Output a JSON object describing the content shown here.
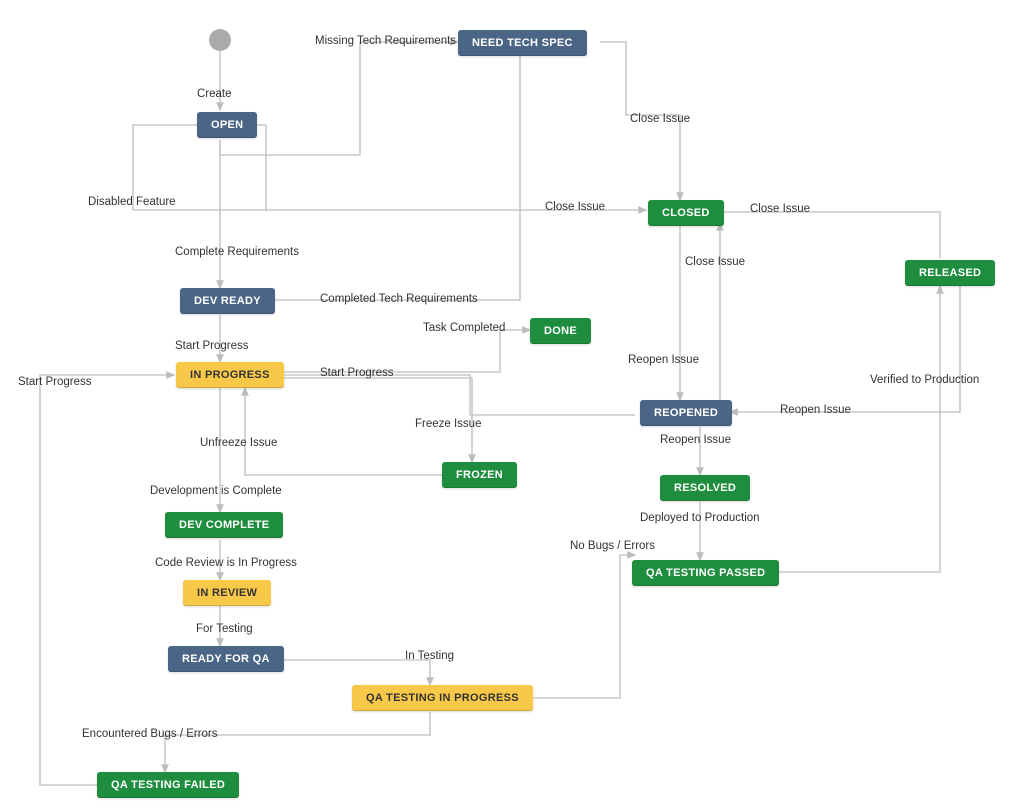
{
  "diagram": {
    "type": "workflow-state-diagram",
    "nodes": {
      "start": {
        "kind": "start"
      },
      "open": {
        "label": "OPEN",
        "color": "blue"
      },
      "need_tech_spec": {
        "label": "NEED TECH SPEC",
        "color": "blue"
      },
      "dev_ready": {
        "label": "DEV READY",
        "color": "blue"
      },
      "in_progress": {
        "label": "IN PROGRESS",
        "color": "yellow"
      },
      "frozen": {
        "label": "FROZEN",
        "color": "green"
      },
      "done": {
        "label": "DONE",
        "color": "green"
      },
      "dev_complete": {
        "label": "DEV COMPLETE",
        "color": "green"
      },
      "in_review": {
        "label": "IN REVIEW",
        "color": "yellow"
      },
      "ready_for_qa": {
        "label": "READY FOR QA",
        "color": "blue"
      },
      "qa_in_progress": {
        "label": "QA TESTING IN PROGRESS",
        "color": "yellow"
      },
      "qa_failed": {
        "label": "QA TESTING FAILED",
        "color": "green"
      },
      "closed": {
        "label": "CLOSED",
        "color": "green"
      },
      "reopened": {
        "label": "REOPENED",
        "color": "blue"
      },
      "resolved": {
        "label": "RESOLVED",
        "color": "green"
      },
      "qa_passed": {
        "label": "QA TESTING PASSED",
        "color": "green"
      },
      "released": {
        "label": "RELEASED",
        "color": "green"
      }
    },
    "transitions": {
      "create": {
        "label": "Create",
        "from": "start",
        "to": "open"
      },
      "missing_tech_req": {
        "label": "Missing Tech Requirements",
        "from": "open",
        "to": "need_tech_spec"
      },
      "close_from_spec": {
        "label": "Close Issue",
        "from": "need_tech_spec",
        "to": "closed"
      },
      "disabled_feature": {
        "label": "Disabled Feature",
        "from": "open",
        "to": "closed"
      },
      "close_issue_open": {
        "label": "Close Issue",
        "from": "open",
        "to": "closed"
      },
      "complete_requirements": {
        "label": "Complete Requirements",
        "from": "open",
        "to": "dev_ready"
      },
      "completed_tech_req": {
        "label": "Completed Tech Requirements",
        "from": "need_tech_spec",
        "to": "dev_ready"
      },
      "start_progress": {
        "label": "Start Progress",
        "from": "dev_ready",
        "to": "in_progress"
      },
      "task_completed": {
        "label": "Task Completed",
        "from": "in_progress",
        "to": "done"
      },
      "freeze_issue": {
        "label": "Freeze Issue",
        "from": "in_progress",
        "to": "frozen"
      },
      "unfreeze_issue": {
        "label": "Unfreeze Issue",
        "from": "frozen",
        "to": "in_progress"
      },
      "dev_is_complete": {
        "label": "Development is Complete",
        "from": "in_progress",
        "to": "dev_complete"
      },
      "code_review": {
        "label": "Code Review is In Progress",
        "from": "dev_complete",
        "to": "in_review"
      },
      "for_testing": {
        "label": "For Testing",
        "from": "in_review",
        "to": "ready_for_qa"
      },
      "in_testing": {
        "label": "In Testing",
        "from": "ready_for_qa",
        "to": "qa_in_progress"
      },
      "encountered_bugs": {
        "label": "Encountered Bugs / Errors",
        "from": "qa_in_progress",
        "to": "qa_failed"
      },
      "start_progress_failed": {
        "label": "Start Progress",
        "from": "qa_failed",
        "to": "in_progress"
      },
      "start_progress_reopened": {
        "label": "Start Progress",
        "from": "reopened",
        "to": "in_progress"
      },
      "reopen_from_closed": {
        "label": "Reopen Issue",
        "from": "closed",
        "to": "reopened"
      },
      "reopen_issue_side": {
        "label": "Reopen Issue",
        "from": "released",
        "to": "reopened"
      },
      "reopen_to_resolved": {
        "label": "Reopen Issue",
        "from": "reopened",
        "to": "resolved"
      },
      "close_from_reopened": {
        "label": "Close Issue",
        "from": "reopened",
        "to": "closed"
      },
      "close_from_released": {
        "label": "Close Issue",
        "from": "released",
        "to": "closed"
      },
      "deployed_to_prod": {
        "label": "Deployed to Production",
        "from": "resolved",
        "to": "qa_passed"
      },
      "no_bugs": {
        "label": "No Bugs / Errors",
        "from": "qa_in_progress",
        "to": "qa_passed"
      },
      "verified_to_prod": {
        "label": "Verified to Production",
        "from": "qa_passed",
        "to": "released"
      }
    }
  }
}
